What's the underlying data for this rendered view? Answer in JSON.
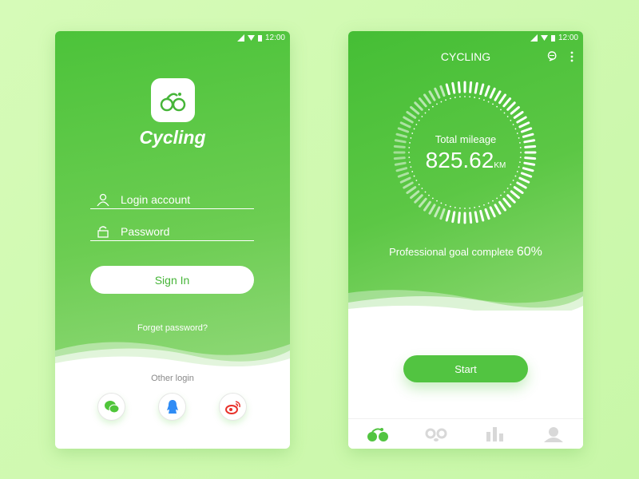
{
  "status_bar": {
    "time": "12:00"
  },
  "login": {
    "app_name": "Cycling",
    "account_placeholder": "Login account",
    "password_placeholder": "Password",
    "sign_in": "Sign In",
    "forgot": "Forget password?",
    "other_login": "Other login",
    "social": [
      "wechat-icon",
      "qq-icon",
      "weibo-icon"
    ]
  },
  "dashboard": {
    "title": "CYCLING",
    "ring_label": "Total mileage",
    "mileage": "825.62",
    "unit": "KM",
    "goal_label": "Professional goal complete",
    "goal_percent": "60%",
    "goal_value": 60,
    "start": "Start",
    "nav": [
      "cycling-icon",
      "route-icon",
      "stats-icon",
      "profile-icon"
    ],
    "active_nav": 0
  },
  "colors": {
    "accent": "#4cc33a",
    "wechat": "#4fc53a",
    "qq": "#2f8cf5",
    "weibo": "#e8312a",
    "inactive": "#d8d8d8"
  }
}
